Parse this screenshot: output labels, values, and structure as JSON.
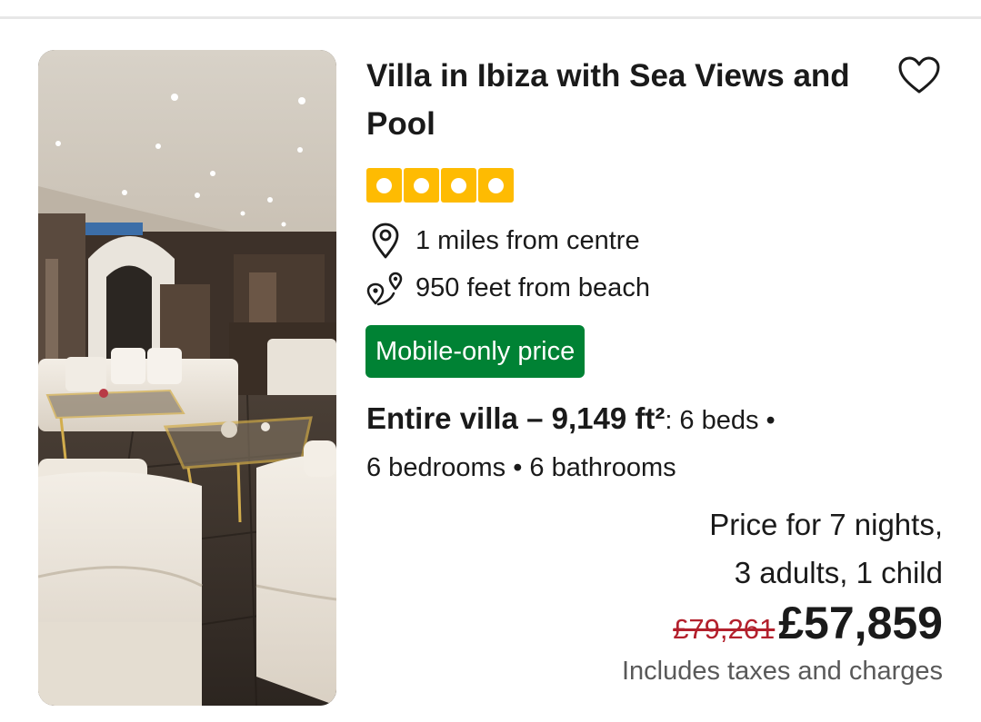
{
  "listing": {
    "title": "Villa in Ibiza with Sea Views and Pool",
    "rating_squares": 4,
    "distance_centre": "1 miles from centre",
    "distance_beach": "950 feet from beach",
    "badge": "Mobile-only price",
    "unit_type": "Entire villa – 9,149 ft²",
    "unit_details_inline": ": 6 beds •",
    "unit_details_second": "6 bedrooms • 6 bathrooms",
    "price_for_line1": "Price for 7 nights,",
    "price_for_line2": "3 adults, 1 child",
    "old_price": "£79,261",
    "new_price": "£57,859",
    "taxes_note": "Includes taxes and charges"
  },
  "icons": {
    "favorite": "heart-outline-icon",
    "location": "map-pin-icon",
    "beach": "route-pin-icon"
  },
  "colors": {
    "rating": "#febb02",
    "badge": "#008234",
    "old_price": "#b3202c",
    "text": "#1a1a1a",
    "muted": "#595959"
  }
}
